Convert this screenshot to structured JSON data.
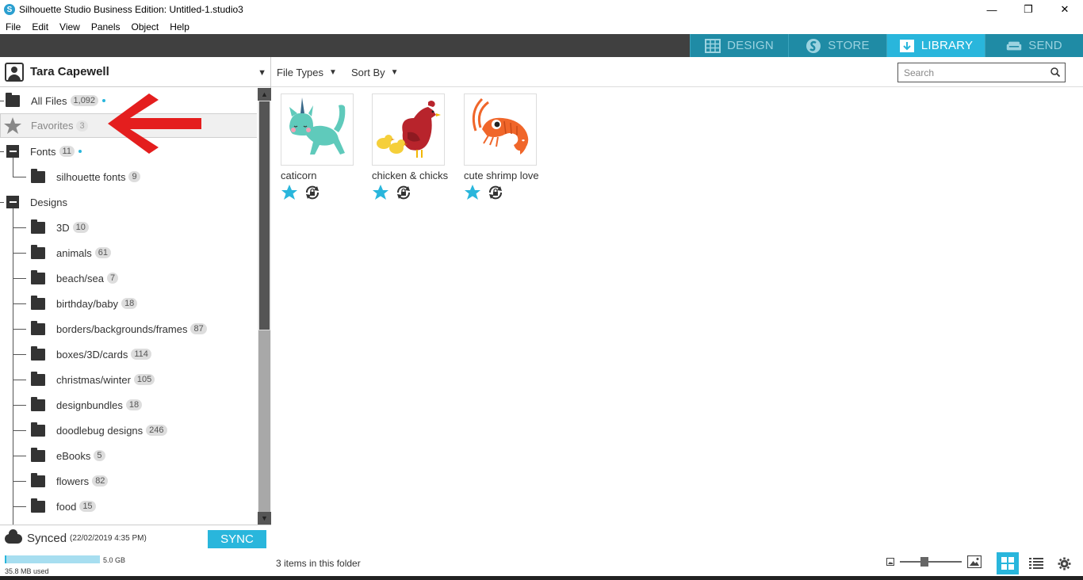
{
  "window": {
    "title": "Silhouette Studio Business Edition: Untitled-1.studio3",
    "minimize": "—",
    "maximize": "❐",
    "close": "✕"
  },
  "menu": [
    "File",
    "Edit",
    "View",
    "Panels",
    "Object",
    "Help"
  ],
  "tabs": [
    {
      "label": "DESIGN",
      "active": false
    },
    {
      "label": "STORE",
      "active": false
    },
    {
      "label": "LIBRARY",
      "active": true
    },
    {
      "label": "SEND",
      "active": false
    }
  ],
  "user": {
    "name": "Tara Capewell"
  },
  "tree": {
    "all_files": {
      "label": "All Files",
      "count": "1,092"
    },
    "favorites": {
      "label": "Favorites",
      "count": "3"
    },
    "fonts": {
      "label": "Fonts",
      "count": "11"
    },
    "silhouette_fonts": {
      "label": "silhouette fonts",
      "count": "9"
    },
    "designs": {
      "label": "Designs"
    },
    "design_folders": [
      {
        "label": "3D",
        "count": "10"
      },
      {
        "label": "animals",
        "count": "61"
      },
      {
        "label": "beach/sea",
        "count": "7"
      },
      {
        "label": "birthday/baby",
        "count": "18"
      },
      {
        "label": "borders/backgrounds/frames",
        "count": "87"
      },
      {
        "label": "boxes/3D/cards",
        "count": "114"
      },
      {
        "label": "christmas/winter",
        "count": "105"
      },
      {
        "label": "designbundles",
        "count": "18"
      },
      {
        "label": "doodlebug designs",
        "count": "246"
      },
      {
        "label": "eBooks",
        "count": "5"
      },
      {
        "label": "flowers",
        "count": "82"
      },
      {
        "label": "food",
        "count": "15"
      }
    ]
  },
  "sync": {
    "status": "Synced",
    "date": "(22/02/2019 4:35 PM)",
    "button": "SYNC",
    "capacity": "5.0 GB",
    "used": "35.8 MB used",
    "used_fraction": 0.007
  },
  "toolbar": {
    "file_types": "File Types",
    "sort_by": "Sort By",
    "search_placeholder": "Search"
  },
  "items": [
    {
      "name": "caticorn",
      "favorite": true
    },
    {
      "name": "chicken & chicks",
      "favorite": true
    },
    {
      "name": "cute shrimp love",
      "favorite": true
    }
  ],
  "status": {
    "text": "3 items in this folder",
    "view": "grid"
  },
  "colors": {
    "accent": "#29b6dc",
    "tab_inactive": "#1f8ba5",
    "arrow": "#e41e1e",
    "dark_bar": "#404040"
  }
}
